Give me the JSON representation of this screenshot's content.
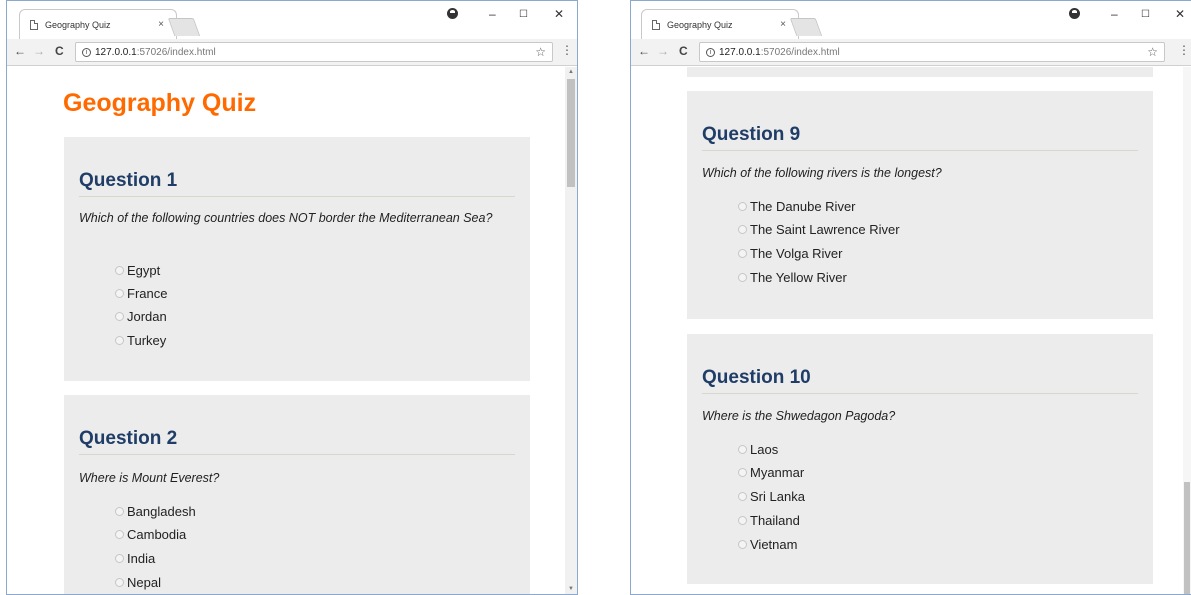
{
  "browser": {
    "tab_title": "Geography Quiz",
    "tab_close": "×",
    "url_host": "127.0.0.1",
    "url_rest": ":57026/index.html",
    "back": "←",
    "forward": "→",
    "reload": "C",
    "info": "i",
    "star": "☆",
    "menu": "⋮",
    "minimize": "–",
    "maximize": "☐",
    "close": "✕"
  },
  "page": {
    "title": "Geography Quiz"
  },
  "questions": [
    {
      "heading": "Question 1",
      "text": "Which of the following countries does NOT border the Mediterranean Sea?",
      "options": [
        "Egypt",
        "France",
        "Jordan",
        "Turkey"
      ]
    },
    {
      "heading": "Question 2",
      "text": "Where is Mount Everest?",
      "options": [
        "Bangladesh",
        "Cambodia",
        "India",
        "Nepal"
      ]
    },
    {
      "heading": "Question 9",
      "text": "Which of the following rivers is the longest?",
      "options": [
        "The Danube River",
        "The Saint Lawrence River",
        "The Volga River",
        "The Yellow River"
      ]
    },
    {
      "heading": "Question 10",
      "text": "Where is the Shwedagon Pagoda?",
      "options": [
        "Laos",
        "Myanmar",
        "Sri Lanka",
        "Thailand",
        "Vietnam"
      ]
    }
  ],
  "colors": {
    "title": "#ff6a00",
    "heading": "#1f3d66",
    "card_bg": "#ececec"
  }
}
